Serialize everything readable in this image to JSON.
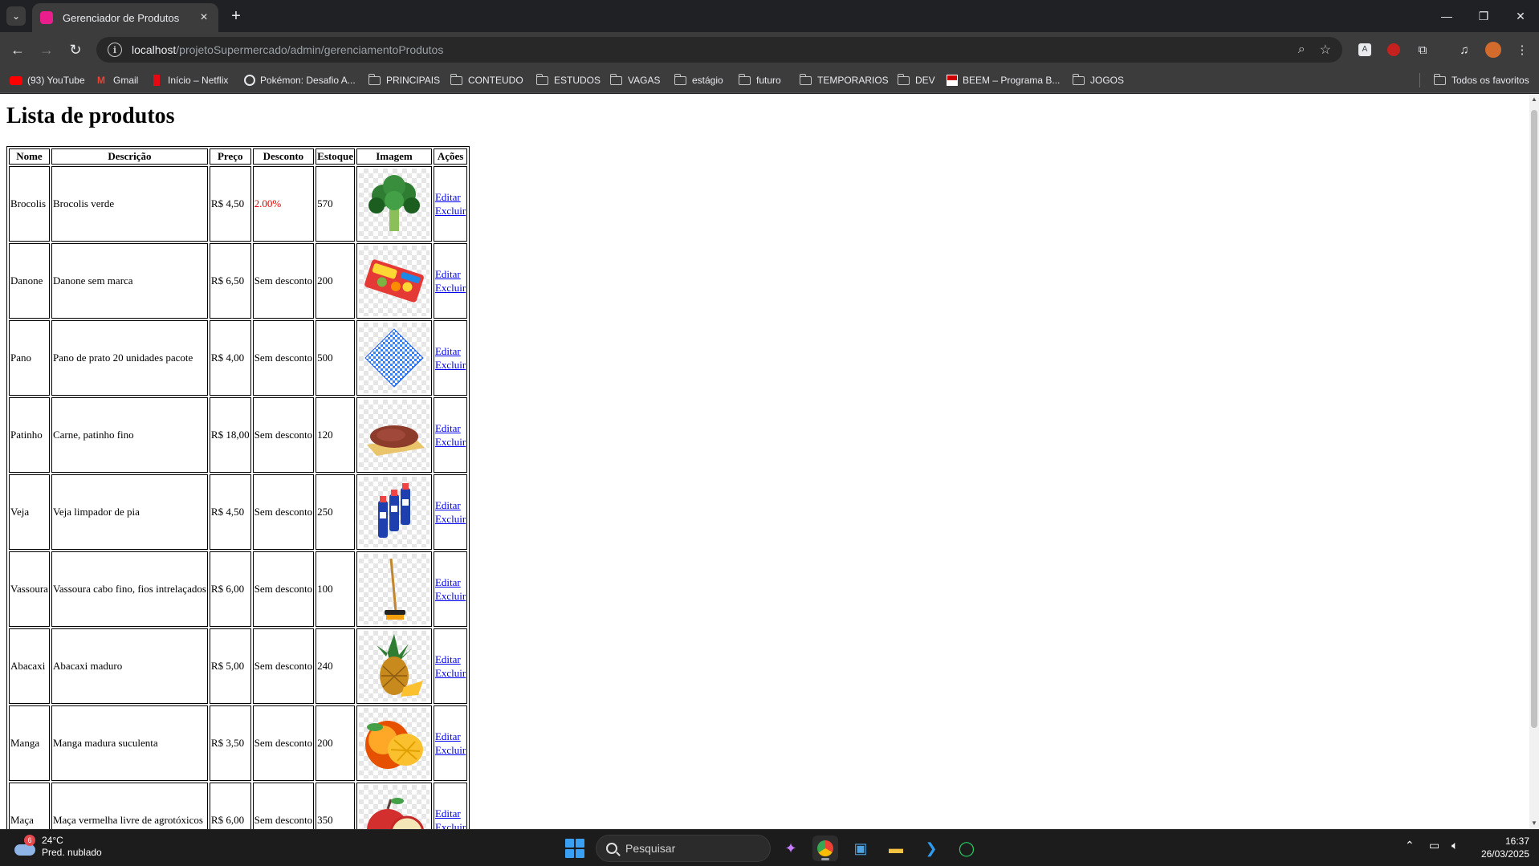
{
  "browser": {
    "tab_title": "Gerenciador de Produtos",
    "url_host": "localhost",
    "url_path": "/projetoSupermercado/admin/gerenciamentoProdutos"
  },
  "bookmarks": [
    {
      "label": "(93) YouTube",
      "icon": "youtube-icon",
      "color": "#ff0000"
    },
    {
      "label": "Gmail",
      "icon": "gmail-icon",
      "color": "#ea4335"
    },
    {
      "label": "Início – Netflix",
      "icon": "netflix-icon",
      "color": "#e50914"
    },
    {
      "label": "Pokémon: Desafio A...",
      "icon": "pokemon-icon",
      "color": "#e8eaed"
    },
    {
      "label": "PRINCIPAIS",
      "icon": "folder-icon"
    },
    {
      "label": "CONTEUDO",
      "icon": "folder-icon"
    },
    {
      "label": "ESTUDOS",
      "icon": "folder-icon"
    },
    {
      "label": "VAGAS",
      "icon": "folder-icon"
    },
    {
      "label": "estágio",
      "icon": "folder-icon"
    },
    {
      "label": "futuro",
      "icon": "folder-icon"
    },
    {
      "label": "TEMPORARIOS",
      "icon": "folder-icon"
    },
    {
      "label": "DEV",
      "icon": "folder-icon"
    },
    {
      "label": "BEEM – Programa B...",
      "icon": "beem-icon",
      "color": "#cc0000"
    },
    {
      "label": "JOGOS",
      "icon": "folder-icon"
    }
  ],
  "all_bookmarks_label": "Todos os favoritos",
  "page": {
    "title": "Lista de produtos",
    "columns": [
      "Nome",
      "Descrição",
      "Preço",
      "Desconto",
      "Estoque",
      "Imagem",
      "Ações"
    ],
    "products": [
      {
        "nome": "Brocolis",
        "descricao": "Brocolis verde",
        "preco": "R$ 4,50",
        "desconto": "2.00%",
        "estoque": "570",
        "imagem": "broccoli"
      },
      {
        "nome": "Danone",
        "descricao": "Danone sem marca",
        "preco": "R$ 6,50",
        "desconto": "Sem desconto",
        "estoque": "200",
        "imagem": "yogurt-pack"
      },
      {
        "nome": "Pano",
        "descricao": "Pano de prato 20 unidades pacote",
        "preco": "R$ 4,00",
        "desconto": "Sem desconto",
        "estoque": "500",
        "imagem": "dish-cloth"
      },
      {
        "nome": "Patinho",
        "descricao": "Carne, patinho fino",
        "preco": "R$ 18,00",
        "desconto": "Sem desconto",
        "estoque": "120",
        "imagem": "beef"
      },
      {
        "nome": "Veja",
        "descricao": "Veja limpador de pia",
        "preco": "R$ 4,50",
        "desconto": "Sem desconto",
        "estoque": "250",
        "imagem": "cleaner-bottles"
      },
      {
        "nome": "Vassoura",
        "descricao": "Vassoura cabo fino, fios intrelaçados",
        "preco": "R$ 6,00",
        "desconto": "Sem desconto",
        "estoque": "100",
        "imagem": "broom"
      },
      {
        "nome": "Abacaxi",
        "descricao": "Abacaxi maduro",
        "preco": "R$ 5,00",
        "desconto": "Sem desconto",
        "estoque": "240",
        "imagem": "pineapple"
      },
      {
        "nome": "Manga",
        "descricao": "Manga madura suculenta",
        "preco": "R$ 3,50",
        "desconto": "Sem desconto",
        "estoque": "200",
        "imagem": "mango"
      },
      {
        "nome": "Maça",
        "descricao": "Maça vermelha livre de agrotóxicos",
        "preco": "R$ 6,00",
        "desconto": "Sem desconto",
        "estoque": "350",
        "imagem": "apple"
      }
    ],
    "actions": {
      "edit": "Editar",
      "delete": "Excluir"
    },
    "discount_color": "#e00000",
    "link_color": "#0000ee"
  },
  "taskbar": {
    "weather_temp": "24°C",
    "weather_desc": "Pred. nublado",
    "weather_badge": "6",
    "search_placeholder": "Pesquisar",
    "time": "16:37",
    "date": "26/03/2025"
  }
}
